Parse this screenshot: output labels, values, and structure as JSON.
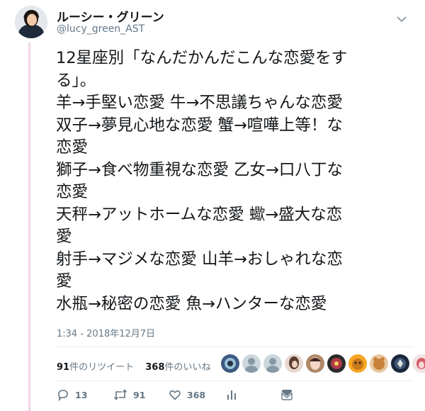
{
  "author": {
    "display_name": "ルーシー・グリーン",
    "handle": "@lucy_green_AST"
  },
  "tweet": {
    "lines": [
      "12星座別「なんだかんだこんな恋愛をす",
      "る」。",
      "羊→手堅い恋愛 牛→不思議ちゃんな恋愛",
      "双子→夢見心地な恋愛 蟹→喧嘩上等！な",
      "恋愛",
      "獅子→食べ物重視な恋愛 乙女→口八丁な",
      "恋愛",
      "天秤→アットホームな恋愛 蠍→盛大な恋",
      "愛",
      "射手→マジメな恋愛 山羊→おしゃれな恋",
      "愛",
      "水瓶→秘密の恋愛 魚→ハンターな恋愛"
    ],
    "timestamp": "1:34 - 2018年12月7日"
  },
  "stats": {
    "retweets_count": "91",
    "retweets_label": "件のリツイート",
    "likes_count": "368",
    "likes_label": "件のいいね"
  },
  "liker_avatars": [
    "liker-avatar-1",
    "liker-avatar-2",
    "liker-avatar-3",
    "liker-avatar-4",
    "liker-avatar-5",
    "liker-avatar-6",
    "liker-avatar-7",
    "liker-avatar-8",
    "liker-avatar-9",
    "liker-avatar-10"
  ],
  "actions": {
    "reply_count": "13",
    "retweet_count": "91",
    "like_count": "368"
  },
  "colors": {
    "text": "#14171a",
    "secondary": "#657786",
    "thread_line": "#f0d6e8",
    "divider": "#e6ecf0"
  }
}
